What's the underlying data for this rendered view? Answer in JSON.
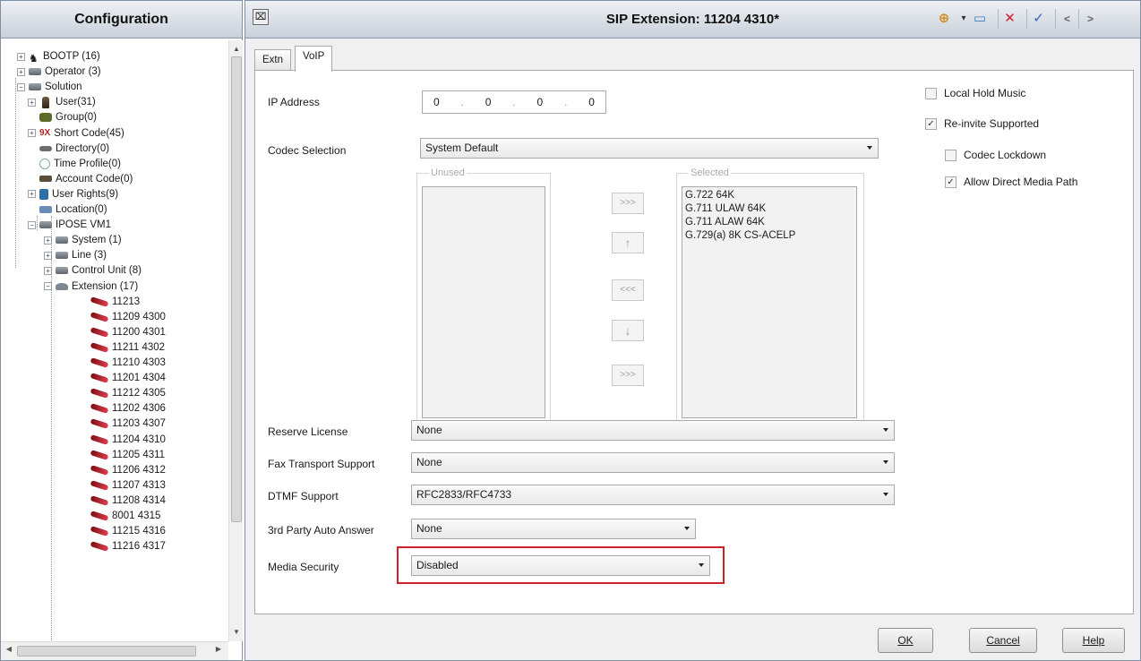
{
  "left": {
    "title": "Configuration",
    "tree": [
      {
        "label": "BOOTP (16)",
        "icon": "bootp-icon",
        "level": 0,
        "expander": "+"
      },
      {
        "label": "Operator (3)",
        "icon": "operator-icon",
        "level": 0,
        "expander": "+"
      },
      {
        "label": "Solution",
        "icon": "solution-icon",
        "level": 0,
        "expander": "−"
      },
      {
        "label": "User(31)",
        "icon": "user-icon",
        "level": 1,
        "expander": "+"
      },
      {
        "label": "Group(0)",
        "icon": "group-icon",
        "level": 1,
        "expander": ""
      },
      {
        "label": "Short Code(45)",
        "icon": "short-code-icon",
        "level": 1,
        "expander": "+",
        "prefix": "9X"
      },
      {
        "label": "Directory(0)",
        "icon": "directory-icon",
        "level": 1,
        "expander": ""
      },
      {
        "label": "Time Profile(0)",
        "icon": "time-profile-icon",
        "level": 1,
        "expander": ""
      },
      {
        "label": "Account Code(0)",
        "icon": "account-code-icon",
        "level": 1,
        "expander": ""
      },
      {
        "label": "User Rights(9)",
        "icon": "user-rights-icon",
        "level": 1,
        "expander": "+"
      },
      {
        "label": "Location(0)",
        "icon": "location-icon",
        "level": 1,
        "expander": ""
      },
      {
        "label": "IPOSE VM1",
        "icon": "system-node-icon",
        "level": 1,
        "expander": "−"
      },
      {
        "label": "System (1)",
        "icon": "system-icon",
        "level": 2,
        "expander": "+"
      },
      {
        "label": "Line (3)",
        "icon": "line-icon",
        "level": 2,
        "expander": "+"
      },
      {
        "label": "Control Unit (8)",
        "icon": "control-unit-icon",
        "level": 2,
        "expander": "+"
      },
      {
        "label": "Extension (17)",
        "icon": "extension-icon",
        "level": 2,
        "expander": "−"
      },
      {
        "label": "11213",
        "icon": "phone-icon",
        "level": 3
      },
      {
        "label": "11209 4300",
        "icon": "phone-icon",
        "level": 3
      },
      {
        "label": "11200 4301",
        "icon": "phone-icon",
        "level": 3
      },
      {
        "label": "11211 4302",
        "icon": "phone-icon",
        "level": 3
      },
      {
        "label": "11210 4303",
        "icon": "phone-icon",
        "level": 3
      },
      {
        "label": "11201 4304",
        "icon": "phone-icon",
        "level": 3
      },
      {
        "label": "11212 4305",
        "icon": "phone-icon",
        "level": 3
      },
      {
        "label": "11202 4306",
        "icon": "phone-icon",
        "level": 3
      },
      {
        "label": "11203 4307",
        "icon": "phone-icon",
        "level": 3
      },
      {
        "label": "11204 4310",
        "icon": "phone-icon",
        "level": 3
      },
      {
        "label": "11205 4311",
        "icon": "phone-icon",
        "level": 3
      },
      {
        "label": "11206 4312",
        "icon": "phone-icon",
        "level": 3
      },
      {
        "label": "11207 4313",
        "icon": "phone-icon",
        "level": 3
      },
      {
        "label": "11208 4314",
        "icon": "phone-icon",
        "level": 3
      },
      {
        "label": "8001 4315",
        "icon": "phone-icon",
        "level": 3
      },
      {
        "label": "11215 4316",
        "icon": "phone-icon",
        "level": 3
      },
      {
        "label": "11216 4317",
        "icon": "phone-icon",
        "level": 3
      }
    ]
  },
  "window": {
    "title": "SIP Extension: 11204 4310*",
    "toolbar": {
      "new": "⊕",
      "dropdown": "▾",
      "save": "▭",
      "delete": "✕",
      "apply": "✓",
      "prev": "<",
      "next": ">"
    }
  },
  "tabs": [
    {
      "label": "Extn",
      "active": false
    },
    {
      "label": "VoIP",
      "active": true
    }
  ],
  "voip": {
    "ip_address": {
      "label": "IP Address",
      "octets": [
        "0",
        "0",
        "0",
        "0"
      ]
    },
    "codec": {
      "label": "Codec Selection",
      "value": "System Default",
      "unused_label": "Unused",
      "selected_label": "Selected",
      "selected_items": [
        "G.722 64K",
        "G.711 ULAW 64K",
        "G.711 ALAW 64K",
        "G.729(a) 8K CS-ACELP"
      ],
      "buttons": [
        ">>>",
        "↑",
        "<<<",
        "↓",
        ">>>"
      ]
    },
    "reserve_license": {
      "label": "Reserve License",
      "value": "None"
    },
    "fax_transport": {
      "label": "Fax Transport Support",
      "value": "None"
    },
    "dtmf": {
      "label": "DTMF Support",
      "value": "RFC2833/RFC4733"
    },
    "third_party": {
      "label": "3rd Party Auto Answer",
      "value": "None"
    },
    "media_security": {
      "label": "Media Security",
      "value": "Disabled"
    },
    "checkboxes": [
      {
        "label": "Local Hold Music",
        "checked": false
      },
      {
        "label": "Re-invite Supported",
        "checked": true
      },
      {
        "label": "Codec Lockdown",
        "checked": false
      },
      {
        "label": "Allow Direct Media Path",
        "checked": true
      }
    ]
  },
  "footer": {
    "ok": "OK",
    "cancel": "Cancel",
    "help": "Help"
  },
  "colors": {
    "highlight": "#d0202a",
    "header_gradient_top": "#eef1f5",
    "header_gradient_bottom": "#c9d0da"
  }
}
